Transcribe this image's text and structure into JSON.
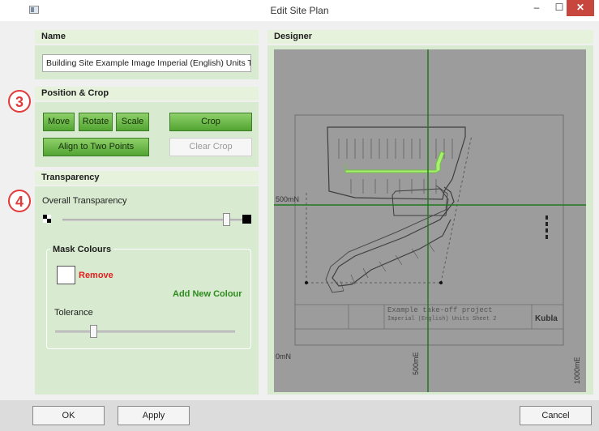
{
  "window": {
    "title": "Edit Site Plan",
    "minimize_glyph": "–",
    "maximize_glyph": "☐",
    "close_glyph": "✕"
  },
  "name_section": {
    "header": "Name",
    "value": "Building Site Example Image Imperial (English) Units Take-off"
  },
  "position_section": {
    "header": "Position & Crop",
    "badge": "3",
    "buttons": {
      "move": "Move",
      "rotate": "Rotate",
      "scale": "Scale",
      "crop": "Crop",
      "align": "Align to Two Points",
      "clear_crop": "Clear Crop"
    }
  },
  "transparency_section": {
    "header": "Transparency",
    "badge": "4",
    "overall_label": "Overall Transparency",
    "overall_value": 0.93,
    "mask": {
      "title": "Mask Colours",
      "remove_label": "Remove",
      "add_label": "Add New Colour",
      "tolerance_label": "Tolerance",
      "tolerance_value": 0.2
    }
  },
  "designer": {
    "header": "Designer",
    "label_500mN": "500mN",
    "label_0mN": "0mN",
    "label_500mE": "500mE",
    "label_1000mE": "1000mE",
    "drawing_title": "Example take-off project",
    "drawing_subtitle": "Imperial (English) Units Sheet 2",
    "logo": "Kubla"
  },
  "footer": {
    "ok": "OK",
    "apply": "Apply",
    "cancel": "Cancel"
  },
  "colors": {
    "accent_green": "#5cb33c",
    "panel_bg": "#d8ebd0",
    "badge_red": "#e03a3a",
    "remove_red": "#e02020",
    "add_green": "#2e8a1e"
  }
}
